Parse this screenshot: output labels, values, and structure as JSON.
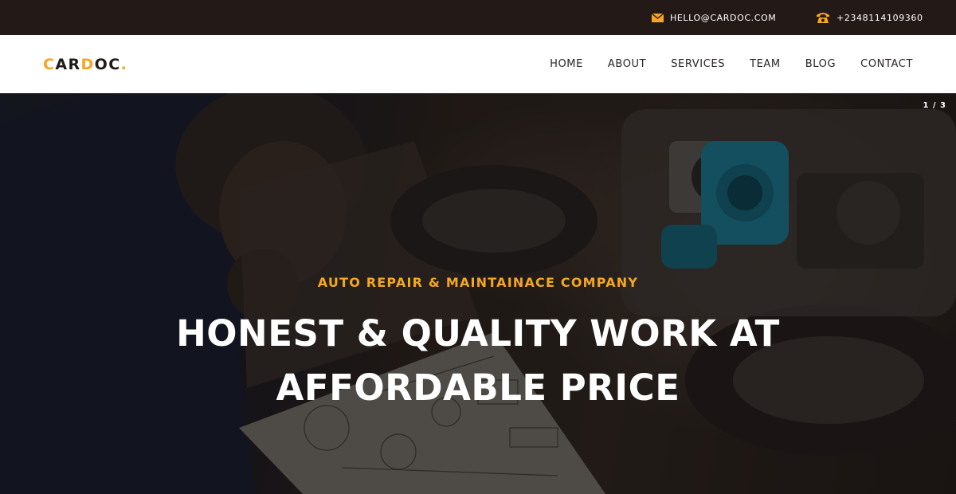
{
  "topbar": {
    "email": "HELLO@CARDOC.COM",
    "phone": "+2348114109360",
    "email_icon": "envelope-icon",
    "phone_icon": "phone-icon"
  },
  "header": {
    "logo_parts": [
      "C",
      "AR",
      "D",
      "OC",
      "."
    ],
    "nav": [
      {
        "label": "HOME"
      },
      {
        "label": "ABOUT"
      },
      {
        "label": "SERVICES"
      },
      {
        "label": "TEAM"
      },
      {
        "label": "BLOG"
      },
      {
        "label": "CONTACT"
      }
    ]
  },
  "hero": {
    "slide_counter": "1 / 3",
    "subtitle": "AUTO REPAIR & MAINTAINACE COMPANY",
    "title_line1": "HONEST & QUALITY WORK AT",
    "title_line2": "AFFORDABLE PRICE"
  },
  "colors": {
    "accent": "#f5a623",
    "topbar_bg": "#231a18",
    "header_bg": "#ffffff",
    "nav_text": "#2a2422"
  }
}
